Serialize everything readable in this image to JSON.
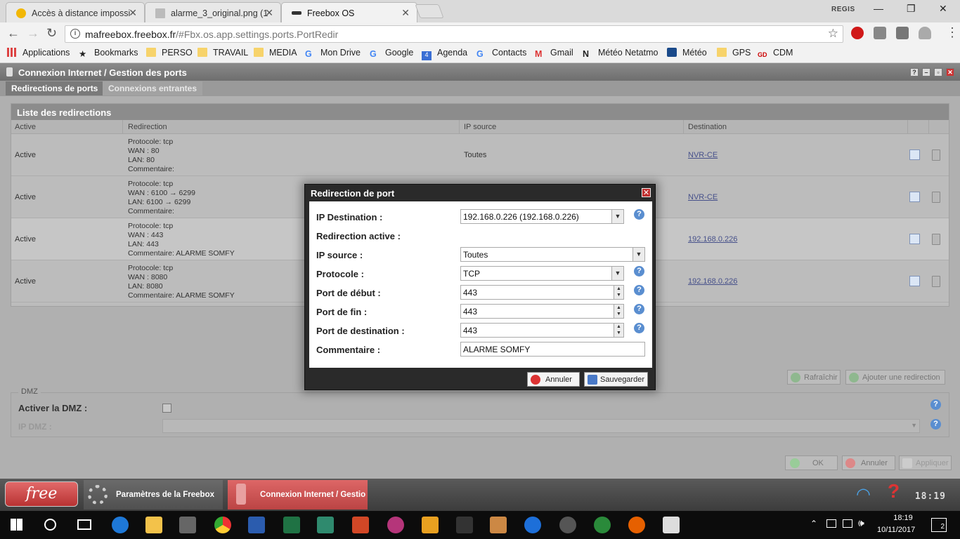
{
  "browser": {
    "tabs": [
      {
        "title": "Accès à distance impossi",
        "icon_color": "#f2b705"
      },
      {
        "title": "alarme_3_original.png (1",
        "icon_color": "#999999"
      },
      {
        "title": "Freebox OS",
        "icon_color": "#333333"
      }
    ],
    "user": "REGIS",
    "url_host": "mafreebox.freebox.fr",
    "url_path": "/#Fbx.os.app.settings.ports.PortRedir",
    "bookmarks": [
      "Applications",
      "Bookmarks",
      "PERSO",
      "TRAVAIL",
      "MEDIA",
      "Mon Drive",
      "Google",
      "Agenda",
      "Contacts",
      "Gmail",
      "Météo Netatmo",
      "Météo",
      "GPS",
      "CDM"
    ]
  },
  "app": {
    "title": "Connexion Internet / Gestion des ports",
    "tabs": [
      "Redirections de ports",
      "Connexions entrantes"
    ],
    "list_title": "Liste des redirections",
    "columns": [
      "Active",
      "Redirection",
      "IP source",
      "Destination"
    ],
    "rows": [
      {
        "active": "Active",
        "protocol": "Protocole: tcp",
        "wan": "WAN : 80",
        "lan": "LAN: 80",
        "comment": "Commentaire:",
        "ip_source": "Toutes",
        "destination": "NVR-CE"
      },
      {
        "active": "Active",
        "protocol": "Protocole: tcp",
        "wan": "WAN : 6100 → 6299",
        "lan": "LAN: 6100 → 6299",
        "comment": "Commentaire:",
        "ip_source": "",
        "destination": "NVR-CE"
      },
      {
        "active": "Active",
        "protocol": "Protocole: tcp",
        "wan": "WAN : 443",
        "lan": "LAN: 443",
        "comment": "Commentaire: ALARME SOMFY",
        "ip_source": "",
        "destination": "192.168.0.226"
      },
      {
        "active": "Active",
        "protocol": "Protocole: tcp",
        "wan": "WAN : 8080",
        "lan": "LAN: 8080",
        "comment": "Commentaire: ALARME SOMFY",
        "ip_source": "",
        "destination": "192.168.0.226"
      }
    ],
    "refresh_label": "Rafraîchir",
    "add_label": "Ajouter une redirection",
    "dmz_legend": "DMZ",
    "dmz_enable_label": "Activer la DMZ :",
    "dmz_ip_label": "IP DMZ :",
    "ok_label": "OK",
    "cancel_label": "Annuler",
    "apply_label": "Appliquer"
  },
  "modal": {
    "title": "Redirection de port",
    "ip_destination_label": "IP Destination :",
    "ip_destination_value": "192.168.0.226 (192.168.0.226)",
    "active_label": "Redirection active :",
    "active_checked": true,
    "ip_source_label": "IP source :",
    "ip_source_value": "Toutes",
    "protocol_label": "Protocole :",
    "protocol_value": "TCP",
    "port_start_label": "Port de début :",
    "port_start_value": "443",
    "port_end_label": "Port de fin :",
    "port_end_value": "443",
    "port_dest_label": "Port de destination :",
    "port_dest_value": "443",
    "comment_label": "Commentaire :",
    "comment_value": "ALARME SOMFY",
    "cancel_label": "Annuler",
    "save_label": "Sauvegarder"
  },
  "freebox_bar": {
    "logo": "free",
    "tasks": [
      "Paramètres de la Freebox",
      "Connexion Internet / Gestio"
    ],
    "clock": "18:19"
  },
  "taskbar": {
    "time": "18:19",
    "date": "10/11/2017",
    "notifications": "2"
  }
}
